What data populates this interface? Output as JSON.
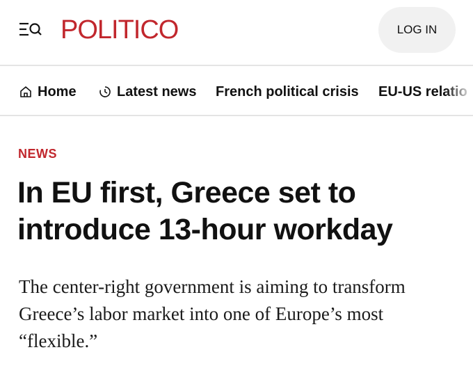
{
  "header": {
    "logo_text": "POLITICO",
    "login_label": "LOG IN",
    "menu_icon": "menu-search-icon",
    "brand_color": "#c1272d"
  },
  "nav": {
    "items": [
      {
        "label": "Home",
        "icon": "home-icon"
      },
      {
        "label": "Latest news",
        "icon": "clock-icon"
      },
      {
        "label": "French political crisis"
      },
      {
        "label": "EU-US relatio"
      }
    ]
  },
  "article": {
    "kicker": "NEWS",
    "headline_line1": "In EU first, Greece set to",
    "headline_line2": "introduce 13-hour workday",
    "dek_line1": "The center-right government is aiming to transform",
    "dek_line2": "Greece’s labor market into one of Europe’s most",
    "dek_line3": "“flexible.”"
  }
}
